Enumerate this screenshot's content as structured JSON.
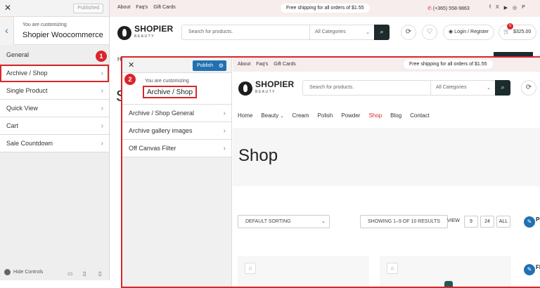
{
  "customizer": {
    "published_label": "Published",
    "you_are_customizing": "You are customizing",
    "site_title": "Shopier Woocommerce",
    "sections": [
      {
        "label": "General"
      },
      {
        "label": "Archive / Shop"
      },
      {
        "label": "Single Product"
      },
      {
        "label": "Quick View"
      },
      {
        "label": "Cart"
      },
      {
        "label": "Sale Countdown"
      }
    ],
    "hide_controls": "Hide Controls"
  },
  "annotations": {
    "step1": "1",
    "step2": "2"
  },
  "store": {
    "top_links": [
      "About",
      "Faq's",
      "Gift Cards"
    ],
    "shipping": "Free shipping for all orders of $1.55",
    "phone": "(+365) 558-9863",
    "logo": "SHOPIER",
    "logo_sub": "BEAUTY",
    "search_placeholder": "Search for products.",
    "categories": "All Categories",
    "account": "Login / Register",
    "cart_total": "$325.00",
    "cart_count": "0",
    "peek_h": "H",
    "peek_s": "S"
  },
  "overlay": {
    "publish": "Publish",
    "you_are_customizing": "You are customizing",
    "section_title": "Archive / Shop",
    "subsections": [
      {
        "label": "Archive / Shop General"
      },
      {
        "label": "Archive gallery images"
      },
      {
        "label": "Off Canvas Filter"
      }
    ],
    "nav": [
      "Home",
      "Beauty",
      "Cream",
      "Polish",
      "Powder",
      "Shop",
      "Blog",
      "Contact"
    ],
    "page_title": "Shop",
    "sorting": "DEFAULT SORTING",
    "results": "SHOWING 1–9 OF 10 RESULTS",
    "view_label": "VIEW",
    "view_options": [
      "9",
      "24",
      "ALL"
    ],
    "side_pr": "PR",
    "side_fi": "FI"
  },
  "colors": {
    "accent_red": "#d9262a",
    "wp_blue": "#2271b1",
    "dark": "#1c2b2b"
  }
}
